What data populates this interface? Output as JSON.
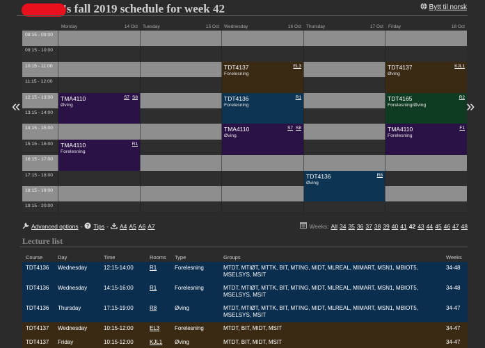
{
  "header": {
    "title": "'s fall 2019 schedule for week 42",
    "lang_link": "Bytt til norsk"
  },
  "calendar": {
    "days": [
      {
        "name": "Monday",
        "date": "14 Oct"
      },
      {
        "name": "Tuesday",
        "date": "15 Oct"
      },
      {
        "name": "Wednesday",
        "date": "16 Oct"
      },
      {
        "name": "Thursday",
        "date": "17 Oct"
      },
      {
        "name": "Friday",
        "date": "18 Oct"
      }
    ],
    "times": [
      "08:15 - 09:00",
      "09:15 - 10:00",
      "10:15 - 11:00",
      "11:15 - 12:00",
      "12:15 - 13:00",
      "13:15 - 14:00",
      "14:15 - 15:00",
      "15:15 - 16:00",
      "16:15 - 17:00",
      "17:15 - 18:00",
      "18:15 - 19:00",
      "19:15 - 20:00"
    ],
    "events": [
      {
        "course": "TMA4110",
        "type": "Øving",
        "rooms": [
          "S7",
          "S8"
        ]
      },
      {
        "course": "TMA4110",
        "type": "Forelesning",
        "rooms": [
          "R1"
        ]
      },
      {
        "course": "TDT4137",
        "type": "Forelesning",
        "rooms": [
          "EL3"
        ]
      },
      {
        "course": "TDT4136",
        "type": "Forelesning",
        "rooms": [
          "R1"
        ]
      },
      {
        "course": "TMA4110",
        "type": "Øving",
        "rooms": [
          "S7",
          "S8"
        ]
      },
      {
        "course": "TDT4136",
        "type": "Øving",
        "rooms": [
          "R8"
        ]
      },
      {
        "course": "TDT4137",
        "type": "Øving",
        "rooms": [
          "KJL1"
        ]
      },
      {
        "course": "TDT4165",
        "type": "Forelesning/Øving",
        "rooms": [
          "R2"
        ]
      },
      {
        "course": "TMA4110",
        "type": "Forelesning",
        "rooms": [
          "F1"
        ]
      }
    ],
    "prev_arrow": "«",
    "next_arrow": "»"
  },
  "toolbar": {
    "advanced": "Advanced options",
    "sep1": "-",
    "tips": "Tips",
    "sep2": "-",
    "sizes": [
      "A4",
      "A5",
      "A6",
      "A7"
    ],
    "weeks_label": "Weeks:",
    "weeks": [
      "All",
      "34",
      "35",
      "36",
      "37",
      "38",
      "39",
      "40",
      "41",
      "42",
      "43",
      "44",
      "45",
      "46",
      "47",
      "48"
    ],
    "current_week": "42"
  },
  "lecture_list": {
    "title": "Lecture list",
    "headers": {
      "course": "Course",
      "day": "Day",
      "time": "Time",
      "rooms": "Rooms",
      "type": "Type",
      "groups": "Groups",
      "weeks": "Weeks"
    },
    "rows": [
      {
        "course": "TDT4136",
        "day": "Wednesday",
        "time": "12:15-14:00",
        "rooms": "R1",
        "type": "Forelesning",
        "groups": "MTDT, MTIØT, MTTK, BIT, MTING, MIDT, MLREAL, MIMART, MSN1, MBIOT5, MSELSYS, MSIT",
        "weeks": "34-48"
      },
      {
        "course": "TDT4136",
        "day": "Wednesday",
        "time": "14:15-16:00",
        "rooms": "R1",
        "type": "Forelesning",
        "groups": "MTDT, MTIØT, MTTK, BIT, MTING, MIDT, MLREAL, MIMART, MSN1, MBIOT5, MSELSYS, MSIT",
        "weeks": "34-48"
      },
      {
        "course": "TDT4136",
        "day": "Thursday",
        "time": "17:15-19:00",
        "rooms": "R8",
        "type": "Øving",
        "groups": "MTDT, MTIØT, MTTK, BIT, MTING, MIDT, MLREAL, MIMART, MSN1, MBIOT5, MSELSYS, MSIT",
        "weeks": "34-47"
      },
      {
        "course": "TDT4137",
        "day": "Wednesday",
        "time": "10:15-12:00",
        "rooms": "EL3",
        "type": "Forelesning",
        "groups": "MTDT, BIT, MIDT, MSIT",
        "weeks": "34-47"
      },
      {
        "course": "TDT4137",
        "day": "Friday",
        "time": "10:15-12:00",
        "rooms": "KJL1",
        "type": "Øving",
        "groups": "MTDT, BIT, MIDT, MSIT",
        "weeks": "34-47"
      }
    ]
  },
  "colors": {
    "background": "#2b2b2b",
    "tma4110": "#2a1246",
    "tdt4137": "#3a2a14",
    "tdt4136": "#0e3453",
    "tdt4165": "#0e3b22",
    "redaction": "#e8101c"
  },
  "icons": {
    "globe": "globe-icon",
    "wrench": "wrench-icon",
    "help": "help-icon",
    "download": "download-icon",
    "calendar": "calendar-icon"
  }
}
